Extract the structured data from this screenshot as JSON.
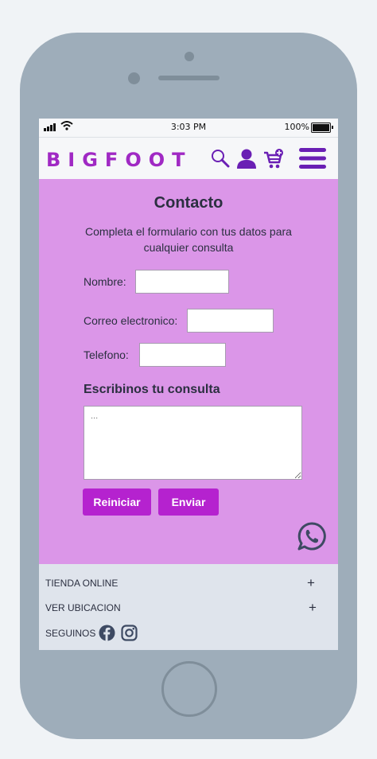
{
  "status_bar": {
    "time": "3:03 PM",
    "battery": "100%"
  },
  "header": {
    "logo": "BIGFOOT",
    "icons": [
      "search-icon",
      "user-icon",
      "cart-add-icon",
      "hamburger-menu-icon"
    ]
  },
  "contact": {
    "title": "Contacto",
    "subtitle": "Completa el formulario con tus datos para cualquier consulta",
    "fields": {
      "name_label": "Nombre:",
      "email_label": "Correo electronico:",
      "phone_label": "Telefono:"
    },
    "query_title": "Escribinos tu consulta",
    "query_placeholder": "...",
    "reset_label": "Reiniciar",
    "send_label": "Enviar"
  },
  "footer": {
    "store_label": "TIENDA ONLINE",
    "location_label": "VER UBICACION",
    "follow_label": "SEGUINOS",
    "social_icons": [
      "facebook-icon",
      "instagram-icon"
    ]
  },
  "colors": {
    "brand": "#a029c4",
    "button": "#b522cf",
    "main_bg": "#db96e8",
    "footer_bg": "#dfe4ec"
  }
}
